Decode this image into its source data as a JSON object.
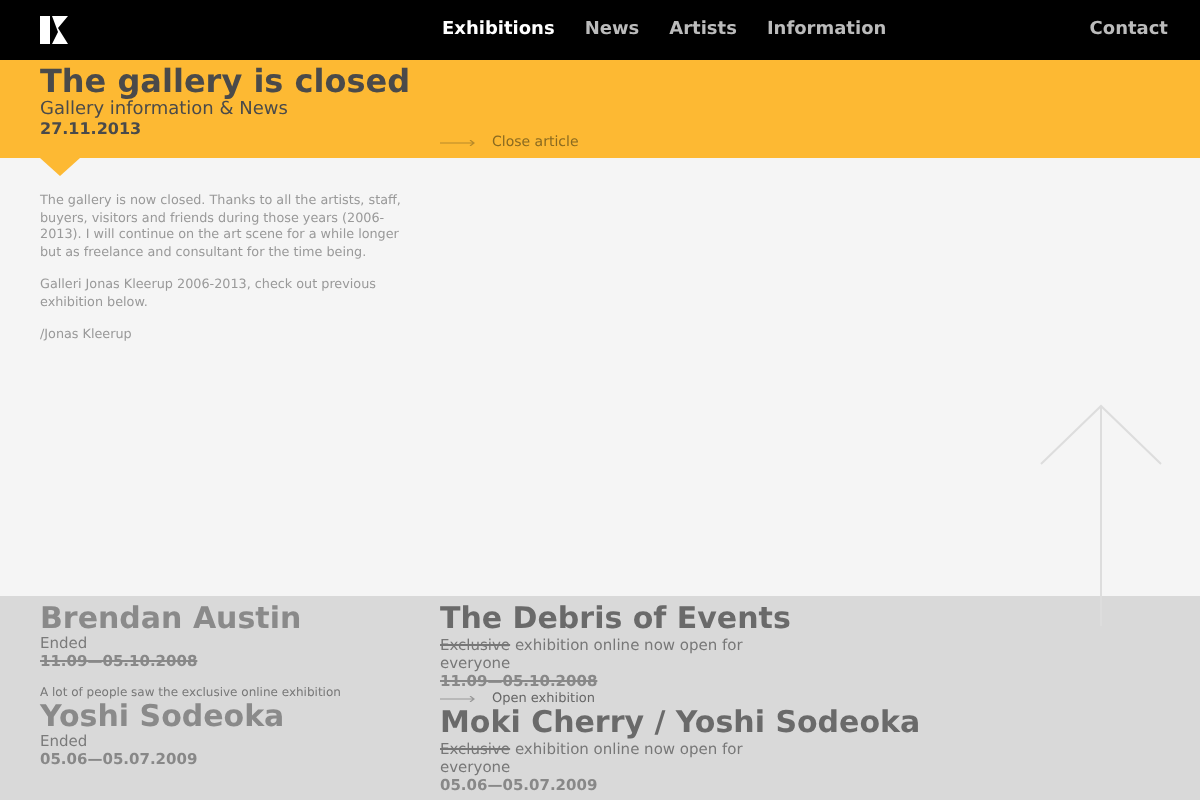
{
  "nav": {
    "items": [
      {
        "label": "Exhibitions",
        "selected": true
      },
      {
        "label": "News",
        "selected": false
      },
      {
        "label": "Artists",
        "selected": false
      },
      {
        "label": "Information",
        "selected": false
      }
    ],
    "contact": "Contact"
  },
  "article": {
    "title": "The gallery is closed",
    "subtitle": "Gallery information & News",
    "date": "27.11.2013",
    "close_link": "Close article",
    "paragraphs": [
      "The gallery is now closed. Thanks to all the artists, staff, buyers, visitors and friends during those years (2006-2013). I will continue on the art scene for a while longer but as freelance and consultant for the time being.",
      "Galleri Jonas Kleerup 2006-2013, check out previous exhibition below.",
      "/Jonas Kleerup"
    ]
  },
  "exhibitions": {
    "left": [
      {
        "kind": "ended",
        "title": "Brendan Austin",
        "status": "Ended",
        "dates": "11.09—05.10.2008",
        "struck": true
      },
      {
        "kind": "note",
        "text": "A lot of people saw the exclusive online exhibition"
      },
      {
        "kind": "ended",
        "title": "Yoshi Sodeoka",
        "status": "Ended",
        "dates": "05.06—05.07.2009",
        "struck": false
      }
    ],
    "right": [
      {
        "kind": "online",
        "title": "The Debris of Events",
        "struck_word": "Exclusive",
        "description": " exhibition online now open for everyone",
        "dates": "11.09—05.10.2008",
        "struck": true,
        "link": "Open exhibition"
      },
      {
        "kind": "online",
        "title": "Moki Cherry / Yoshi Sodeoka",
        "struck_word": "Exclusive",
        "description": " exhibition online now open for everyone",
        "dates": "05.06—05.07.2009",
        "struck": false
      }
    ]
  }
}
